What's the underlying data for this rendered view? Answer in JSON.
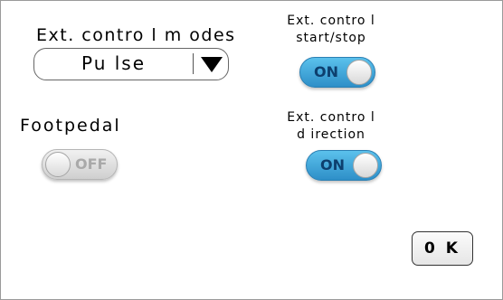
{
  "ext_control_modes": {
    "label": "Ext. contro l m odes",
    "selected": "Pu lse",
    "arrow_icon": "triangle-down-icon"
  },
  "ext_control_start_stop": {
    "label_line1": "Ext. contro l",
    "label_line2": "start/stop",
    "state": "ON"
  },
  "footpedal": {
    "label": "Footpedal",
    "state": "OFF"
  },
  "ext_control_direction": {
    "label_line1": "Ext. contro l",
    "label_line2": "d irection",
    "state": "ON"
  },
  "ok_button": {
    "label": "0 K"
  },
  "colors": {
    "toggle_on": "#2e8fc8",
    "toggle_off": "#cfcfcf",
    "toggle_on_text": "#0d3f6e",
    "toggle_off_text": "#a9a9a9"
  }
}
